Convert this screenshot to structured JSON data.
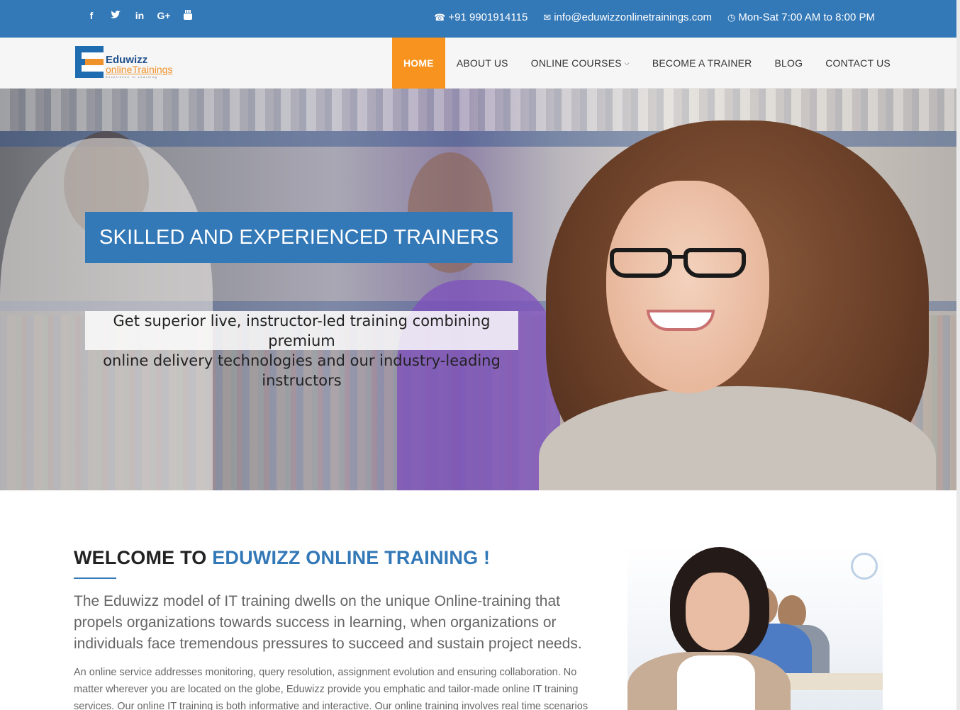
{
  "topbar": {
    "social": [
      {
        "name": "facebook",
        "glyph": "f"
      },
      {
        "name": "twitter",
        "glyph": "🐦"
      },
      {
        "name": "linkedin",
        "glyph": "in"
      },
      {
        "name": "google-plus",
        "glyph": "G+"
      },
      {
        "name": "youtube",
        "glyph": "▶"
      }
    ],
    "phone": "+91 9901914115",
    "email": "info@eduwizzonlinetrainings.com",
    "hours": "Mon-Sat 7:00 AM to 8:00 PM"
  },
  "brand": {
    "line1": "Eduwizz",
    "line2": "onlineTrainings",
    "tagline": "Excellence in Learning"
  },
  "nav": {
    "items": [
      "HOME",
      "ABOUT US",
      "ONLINE COURSES",
      "BECOME A TRAINER",
      "BLOG",
      "CONTACT US"
    ],
    "active": "HOME"
  },
  "hero": {
    "title": "SKILLED AND EXPERIENCED TRAINERS",
    "subtitle_line1": "Get superior live, instructor-led training combining premium",
    "subtitle_line2": "online delivery technologies and our industry-leading instructors"
  },
  "welcome": {
    "title_prefix": "WELCOME TO",
    "title_accent": "EDUWIZZ ONLINE TRAINING !",
    "lead": "The Eduwizz model of IT training dwells on the unique Online-training that propels organizations towards success in learning, when organizations or individuals face tremendous pressures to succeed and sustain project needs.",
    "body": "An online service addresses monitoring, query resolution, assignment evolution and ensuring collaboration. No matter wherever you are located on the globe, Eduwizz provide you emphatic and tailor-made online IT training services. Our online IT training is both informative and interactive. Our online training involves real time scenarios"
  },
  "colors": {
    "primary": "#3378b7",
    "accent": "#f7931e"
  }
}
